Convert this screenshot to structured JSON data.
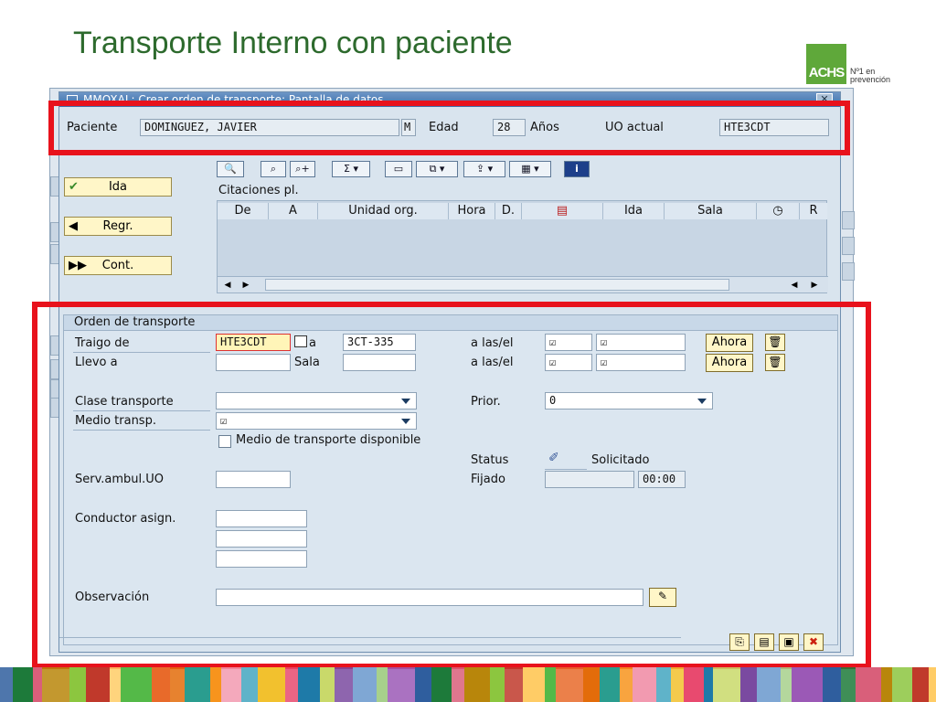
{
  "slide": {
    "title": "Transporte Interno con paciente",
    "logo_text": "ACHS",
    "logo_tagline_1": "Nº1 en",
    "logo_tagline_2": "prevención"
  },
  "window": {
    "title": "MMOXAL: Crear orden de transporte: Pantalla de datos"
  },
  "patient_bar": {
    "paciente_label": "Paciente",
    "paciente_value": "DOMINGUEZ, JAVIER",
    "sex_value": "M",
    "edad_label": "Edad",
    "edad_value": "28",
    "anos_label": "Años",
    "uo_label": "UO actual",
    "uo_value": "HTE3CDT"
  },
  "nav_buttons": {
    "ida": "Ida",
    "regr": "Regr.",
    "cont": "Cont."
  },
  "citaciones": {
    "title": "Citaciones pl.",
    "columns": [
      "De",
      "A",
      "Unidad org.",
      "Hora",
      "D.",
      "",
      "Ida",
      "Sala",
      "",
      "R"
    ]
  },
  "order": {
    "section_title": "Orden de transporte",
    "traigo_label": "Traigo de",
    "traigo_value": "HTE3CDT",
    "a_label": "a",
    "a_value": "3CT-335",
    "a_las_el_1": "a las/el",
    "llevo_label": "Llevo a",
    "sala_label": "Sala",
    "a_las_el_2": "a las/el",
    "ahora_1": "Ahora",
    "ahora_2": "Ahora",
    "clase_label": "Clase transporte",
    "prior_label": "Prior.",
    "prior_value": "0",
    "medio_label": "Medio transp.",
    "medio_disp_label": "Medio de transporte disponible",
    "status_label": "Status",
    "status_value": "Solicitado",
    "serv_label": "Serv.ambul.UO",
    "fijado_label": "Fijado",
    "fijado_time": "00:00",
    "conductor_label": "Conductor asign.",
    "observacion_label": "Observación"
  },
  "colors": {
    "title_green": "#2d6a2d",
    "highlight_red": "#e8121c",
    "sap_panel": "#dbe6f0"
  }
}
